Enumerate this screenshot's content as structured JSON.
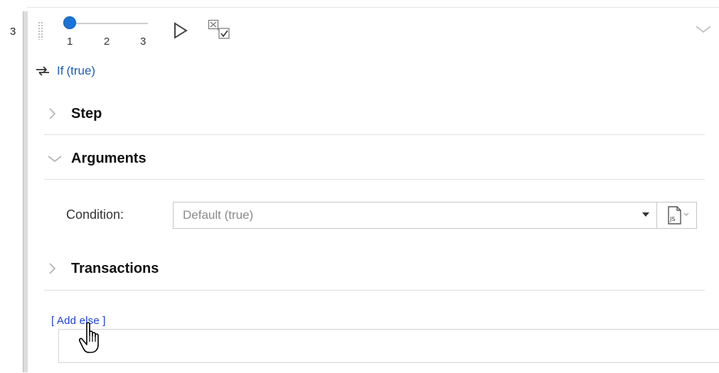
{
  "step": {
    "number": "3"
  },
  "slider": {
    "labels": [
      "1",
      "2",
      "3"
    ],
    "value": 1
  },
  "if_row": {
    "keyword": "If",
    "condition": "(true)"
  },
  "sections": {
    "step": {
      "label": "Step",
      "expanded": false
    },
    "arguments": {
      "label": "Arguments",
      "expanded": true
    },
    "transactions": {
      "label": "Transactions",
      "expanded": false
    }
  },
  "arguments": {
    "condition_label": "Condition:",
    "condition_value": "Default (true)"
  },
  "add_else": {
    "label": "[ Add else ]"
  },
  "icons": {
    "play": "play-icon",
    "transactions": "transactions-checkbox-icon",
    "collapse": "chevron-down-icon",
    "swap": "swap-arrows-icon",
    "script": "js-script-icon"
  },
  "colors": {
    "accent": "#1a73d6",
    "link": "#1a3fd6",
    "keyword": "#1a5fb4"
  }
}
